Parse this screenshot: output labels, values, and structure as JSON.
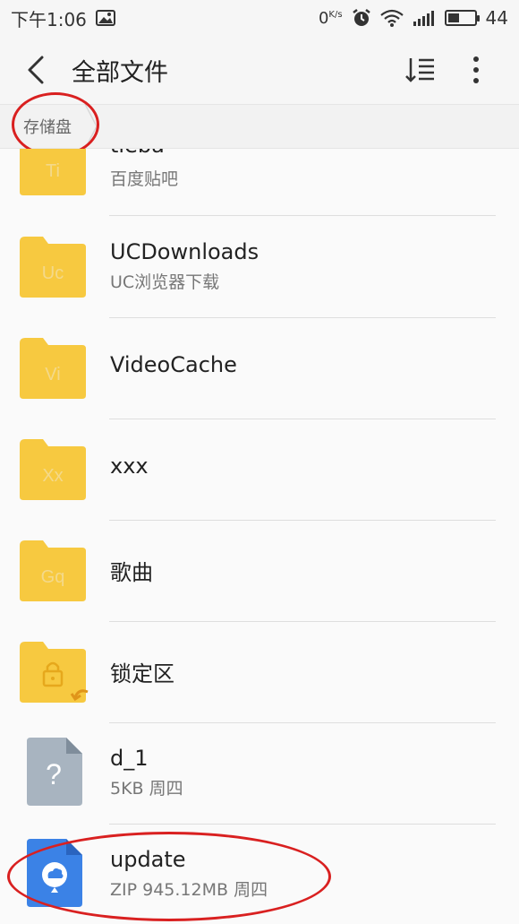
{
  "status_bar": {
    "time": "下午1:06",
    "net_speed_value": "0",
    "net_speed_unit": "K/s",
    "battery_level": "44",
    "battery_fraction": 0.44
  },
  "header": {
    "title": "全部文件",
    "back_icon": "chevron-left-icon",
    "sort_icon": "sort-icon",
    "more_icon": "more-vertical-icon"
  },
  "breadcrumb": {
    "items": [
      "存储盘"
    ]
  },
  "files": [
    {
      "name": "tieba",
      "sub": "百度贴吧",
      "type": "folder",
      "badge": "Ti"
    },
    {
      "name": "UCDownloads",
      "sub": "UC浏览器下载",
      "type": "folder",
      "badge": "Uc"
    },
    {
      "name": "VideoCache",
      "sub": "",
      "type": "folder",
      "badge": "Vi"
    },
    {
      "name": "xxx",
      "sub": "",
      "type": "folder",
      "badge": "Xx"
    },
    {
      "name": "歌曲",
      "sub": "",
      "type": "folder",
      "badge": "Gq"
    },
    {
      "name": "锁定区",
      "sub": "",
      "type": "locked-folder",
      "badge": ""
    },
    {
      "name": "d_1",
      "sub": "5KB  周四",
      "type": "unknown-file",
      "badge": "?"
    },
    {
      "name": "update",
      "sub": "ZIP  945.12MB  周四",
      "type": "zip-file",
      "badge": ""
    }
  ],
  "colors": {
    "folder": "#f7c940",
    "folder_tab": "#f5c033",
    "unknown_file": "#a8b4c0",
    "zip_file": "#3b82e6",
    "annotation": "#d92020"
  }
}
